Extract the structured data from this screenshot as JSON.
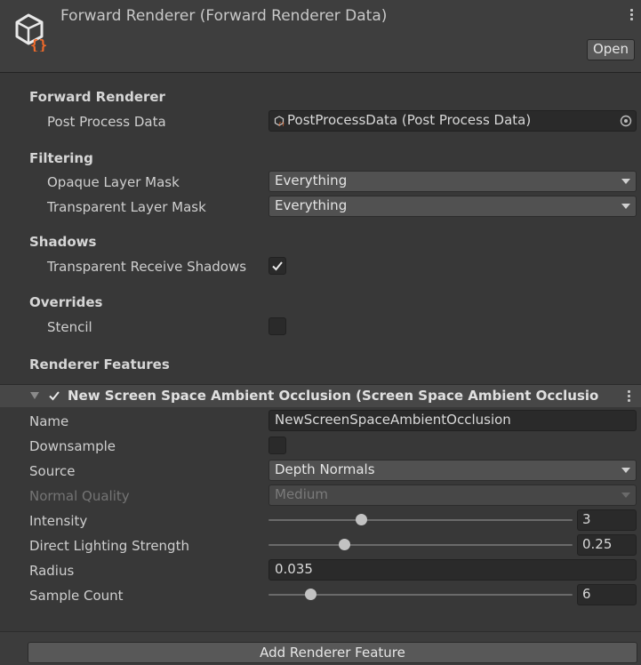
{
  "header": {
    "title": "Forward Renderer (Forward Renderer Data)",
    "open_label": "Open",
    "asset_icon": "scriptable-object-icon",
    "menu_icon": "kebab-menu-icon"
  },
  "forward_renderer": {
    "section_label": "Forward Renderer",
    "post_process_data_label": "Post Process Data",
    "post_process_data_value": "PostProcessData (Post Process Data)"
  },
  "filtering": {
    "section_label": "Filtering",
    "opaque_label": "Opaque Layer Mask",
    "opaque_value": "Everything",
    "transparent_label": "Transparent Layer Mask",
    "transparent_value": "Everything"
  },
  "shadows": {
    "section_label": "Shadows",
    "transparent_receive_label": "Transparent Receive Shadows",
    "transparent_receive_checked": true
  },
  "overrides": {
    "section_label": "Overrides",
    "stencil_label": "Stencil",
    "stencil_checked": false
  },
  "renderer_features": {
    "section_label": "Renderer Features",
    "feature": {
      "enabled": true,
      "title": "New Screen Space Ambient Occlusion (Screen Space Ambient Occlusio",
      "name_label": "Name",
      "name_value": "NewScreenSpaceAmbientOcclusion",
      "downsample_label": "Downsample",
      "downsample_checked": false,
      "source_label": "Source",
      "source_value": "Depth Normals",
      "normal_quality_label": "Normal Quality",
      "normal_quality_value": "Medium",
      "intensity_label": "Intensity",
      "intensity_value": "3",
      "intensity_fraction": 0.305,
      "direct_lighting_label": "Direct Lighting Strength",
      "direct_lighting_value": "0.25",
      "direct_lighting_fraction": 0.25,
      "radius_label": "Radius",
      "radius_value": "0.035",
      "sample_count_label": "Sample Count",
      "sample_count_value": "6",
      "sample_count_fraction": 0.14
    },
    "add_button_label": "Add Renderer Feature"
  },
  "colors": {
    "background": "#383838",
    "header": "#3e3e3e",
    "field": "#2a2a2a",
    "dropdown": "#515151",
    "asset_icon_outline": "#e8e8e8",
    "asset_icon_braces": "#f06a2a"
  }
}
